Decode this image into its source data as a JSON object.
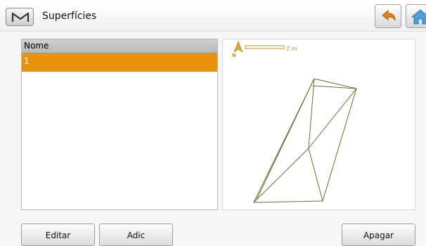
{
  "header": {
    "title": "Superfícies",
    "menu_icon": "m-logo-icon",
    "back_icon": "undo-arrow-icon",
    "home_icon": "home-icon"
  },
  "list": {
    "column_header": "Nome",
    "rows": [
      {
        "name": "1",
        "selected": true
      }
    ]
  },
  "map": {
    "north_label": "N",
    "scale_label": "2 m"
  },
  "buttons": {
    "edit": "Editar",
    "add": "Adic",
    "delete": "Apagar"
  },
  "colors": {
    "selection": "#e8920e",
    "accent": "#c8930c",
    "home_blue": "#4d9fd8",
    "surface_lines": "#6f6a36"
  }
}
